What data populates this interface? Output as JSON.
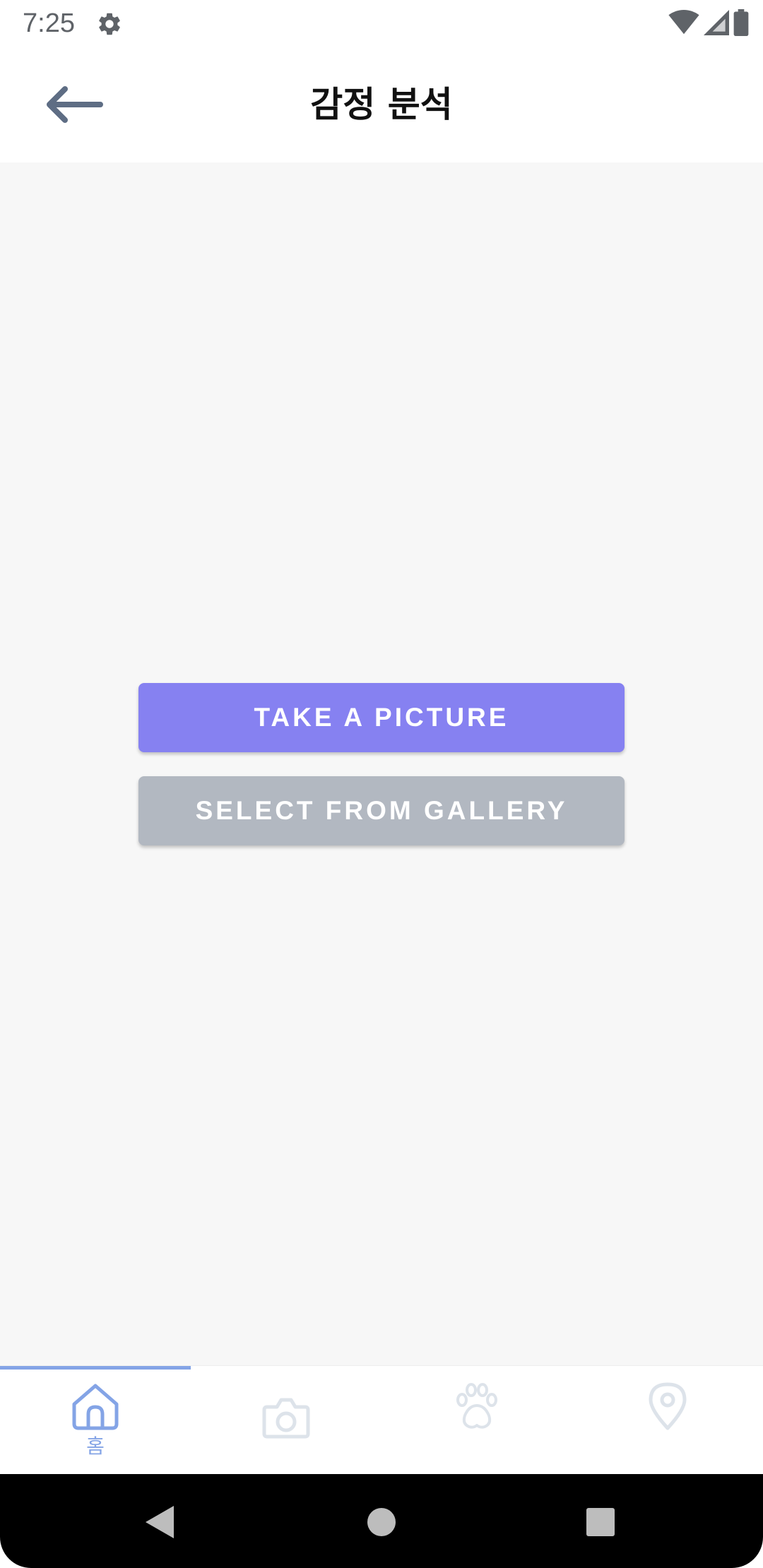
{
  "status_bar": {
    "time": "7:25",
    "icons": [
      "gear-icon",
      "wifi-icon",
      "signal-icon",
      "battery-icon"
    ]
  },
  "app_bar": {
    "title": "감정 분석",
    "back_icon": "arrow-left-icon"
  },
  "actions": {
    "take_picture_label": "TAKE A PICTURE",
    "select_gallery_label": "SELECT FROM GALLERY"
  },
  "bottom_nav": {
    "items": [
      {
        "icon": "home-icon",
        "label": "홈",
        "active": true
      },
      {
        "icon": "camera-icon",
        "label": "",
        "active": false
      },
      {
        "icon": "paw-icon",
        "label": "",
        "active": false
      },
      {
        "icon": "map-pin-icon",
        "label": "",
        "active": false
      }
    ]
  },
  "system_nav": {
    "icons": [
      "back-triangle-icon",
      "home-circle-icon",
      "recents-square-icon"
    ]
  },
  "colors": {
    "primary_button": "#8681f1",
    "secondary_button": "#b2b8c1",
    "nav_active": "#84a4e6",
    "nav_inactive": "#dde3ea",
    "background": "#f7f7f7"
  }
}
